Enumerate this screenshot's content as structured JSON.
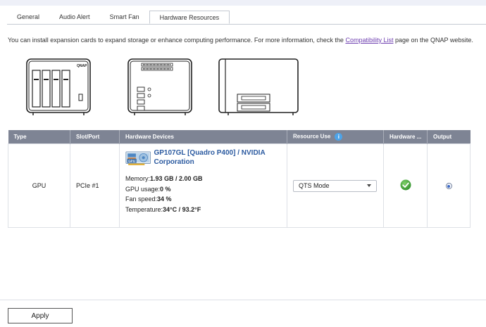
{
  "tabs": [
    {
      "label": "General"
    },
    {
      "label": "Audio Alert"
    },
    {
      "label": "Smart Fan"
    },
    {
      "label": "Hardware Resources"
    }
  ],
  "active_tab": "Hardware Resources",
  "info": {
    "text_before": "You can install expansion cards to expand storage or enhance computing performance. For more information, check the ",
    "link": "Compatibility List",
    "text_after": " page on the QNAP website."
  },
  "device_brand": "QNAP",
  "table": {
    "headers": {
      "type": "Type",
      "slot": "Slot/Port",
      "devices": "Hardware Devices",
      "resource": "Resource Use",
      "hardware": "Hardware ...",
      "output": "Output"
    },
    "row": {
      "type": "GPU",
      "slot": "PCIe #1",
      "gpu_badge": "GPU",
      "device_name": "GP107GL [Quadro P400] / NVIDIA Corporation",
      "memory_label": "Memory:",
      "memory_value": "1.93 GB / 2.00 GB",
      "usage_label": "GPU usage:",
      "usage_value": "0 %",
      "fan_label": "Fan speed:",
      "fan_value": "34 %",
      "temp_label": "Temperature:",
      "temp_value": "34°C / 93.2°F",
      "resource_use": "QTS Mode",
      "hardware_status": "ok",
      "output_selected": true
    }
  },
  "footer": {
    "apply": "Apply"
  },
  "colors": {
    "header_bg": "#7e8494",
    "link": "#6e3fb0",
    "device_name": "#2b5aa0",
    "status_ok": "#3fa63b",
    "info_icon": "#4da3e8"
  }
}
